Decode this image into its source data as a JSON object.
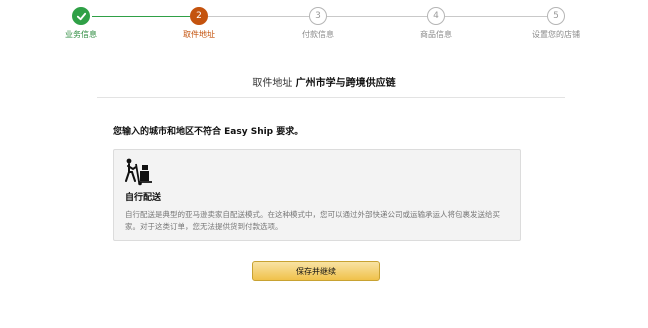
{
  "stepper": {
    "steps": [
      {
        "label": "业务信息",
        "number": "",
        "state": "done"
      },
      {
        "label": "取件地址",
        "number": "2",
        "state": "active"
      },
      {
        "label": "付款信息",
        "number": "3",
        "state": "pending"
      },
      {
        "label": "商品信息",
        "number": "4",
        "state": "pending"
      },
      {
        "label": "设置您的店铺",
        "number": "5",
        "state": "pending"
      }
    ],
    "colors": {
      "done": "#2fa046",
      "active": "#c4530e",
      "pending": "#b5b5b5"
    }
  },
  "header": {
    "prefix": "取件地址",
    "company": "广州市学与跨境供应链"
  },
  "warning": "您输入的城市和地区不符合 Easy Ship 要求。",
  "option": {
    "icon": "hand-truck-icon",
    "title": "自行配送",
    "description": "自行配送是典型的亚马逊卖家自配送模式。在这种模式中，您可以通过外部快递公司或运输承运人将包裹发送给买家。对于这类订单，您无法提供货到付款选项。"
  },
  "actions": {
    "save_label": "保存并继续",
    "accent": "#f0c14b"
  }
}
